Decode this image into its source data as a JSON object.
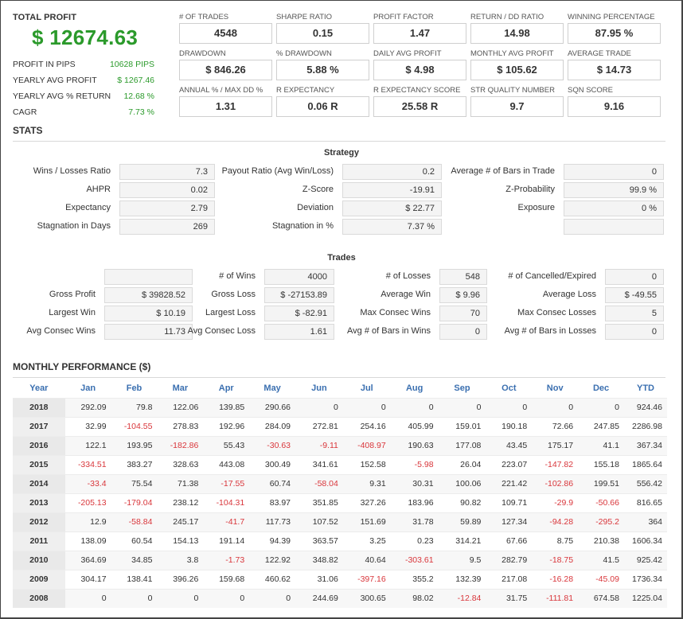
{
  "summary": {
    "title": "TOTAL PROFIT",
    "total": "$ 12674.63",
    "rows": [
      {
        "k": "PROFIT IN PIPS",
        "v": "10628 PIPS"
      },
      {
        "k": "YEARLY AVG PROFIT",
        "v": "$ 1267.46"
      },
      {
        "k": "YEARLY AVG % RETURN",
        "v": "12.68 %"
      },
      {
        "k": "CAGR",
        "v": "7.73 %"
      }
    ]
  },
  "kpis": [
    {
      "t": "# OF TRADES",
      "v": "4548"
    },
    {
      "t": "SHARPE RATIO",
      "v": "0.15"
    },
    {
      "t": "PROFIT FACTOR",
      "v": "1.47"
    },
    {
      "t": "RETURN / DD RATIO",
      "v": "14.98"
    },
    {
      "t": "WINNING PERCENTAGE",
      "v": "87.95 %"
    },
    {
      "t": "DRAWDOWN",
      "v": "$ 846.26"
    },
    {
      "t": "% DRAWDOWN",
      "v": "5.88 %"
    },
    {
      "t": "DAILY AVG PROFIT",
      "v": "$ 4.98"
    },
    {
      "t": "MONTHLY AVG PROFIT",
      "v": "$ 105.62"
    },
    {
      "t": "AVERAGE TRADE",
      "v": "$ 14.73"
    },
    {
      "t": "ANNUAL % / MAX DD %",
      "v": "1.31"
    },
    {
      "t": "R EXPECTANCY",
      "v": "0.06 R"
    },
    {
      "t": "R EXPECTANCY SCORE",
      "v": "25.58 R"
    },
    {
      "t": "STR QUALITY NUMBER",
      "v": "9.7"
    },
    {
      "t": "SQN SCORE",
      "v": "9.16"
    }
  ],
  "stats": {
    "title": "STATS",
    "strategy_title": "Strategy",
    "strategy": [
      [
        {
          "l": "Wins / Losses Ratio",
          "v": "7.3"
        },
        {
          "l": "Payout Ratio (Avg Win/Loss)",
          "v": "0.2"
        },
        {
          "l": "Average # of Bars in Trade",
          "v": "0"
        }
      ],
      [
        {
          "l": "AHPR",
          "v": "0.02"
        },
        {
          "l": "Z-Score",
          "v": "-19.91"
        },
        {
          "l": "Z-Probability",
          "v": "99.9 %"
        }
      ],
      [
        {
          "l": "Expectancy",
          "v": "2.79"
        },
        {
          "l": "Deviation",
          "v": "$ 22.77"
        },
        {
          "l": "Exposure",
          "v": "0 %"
        }
      ],
      [
        {
          "l": "Stagnation in Days",
          "v": "269"
        },
        {
          "l": "Stagnation in %",
          "v": "7.37 %"
        },
        {
          "l": "",
          "v": ""
        }
      ]
    ],
    "trades_title": "Trades",
    "trades": [
      [
        {
          "l": "",
          "v": ""
        },
        {
          "l": "# of Wins",
          "v": "4000"
        },
        {
          "l": "# of Losses",
          "v": "548"
        },
        {
          "l": "# of Cancelled/Expired",
          "v": "0"
        }
      ],
      [
        {
          "l": "Gross Profit",
          "v": "$ 39828.52"
        },
        {
          "l": "Gross Loss",
          "v": "$ -27153.89"
        },
        {
          "l": "Average Win",
          "v": "$ 9.96"
        },
        {
          "l": "Average Loss",
          "v": "$ -49.55"
        }
      ],
      [
        {
          "l": "Largest Win",
          "v": "$ 10.19"
        },
        {
          "l": "Largest Loss",
          "v": "$ -82.91"
        },
        {
          "l": "Max Consec Wins",
          "v": "70"
        },
        {
          "l": "Max Consec Losses",
          "v": "5"
        }
      ],
      [
        {
          "l": "Avg Consec Wins",
          "v": "11.73"
        },
        {
          "l": "Avg Consec Loss",
          "v": "1.61"
        },
        {
          "l": "Avg # of Bars in Wins",
          "v": "0"
        },
        {
          "l": "Avg # of Bars in Losses",
          "v": "0"
        }
      ]
    ]
  },
  "monthly": {
    "title": "MONTHLY PERFORMANCE ($)",
    "headers": [
      "Year",
      "Jan",
      "Feb",
      "Mar",
      "Apr",
      "May",
      "Jun",
      "Jul",
      "Aug",
      "Sep",
      "Oct",
      "Nov",
      "Dec",
      "YTD"
    ],
    "rows": [
      [
        "2018",
        "292.09",
        "79.8",
        "122.06",
        "139.85",
        "290.66",
        "0",
        "0",
        "0",
        "0",
        "0",
        "0",
        "0",
        "924.46"
      ],
      [
        "2017",
        "32.99",
        "-104.55",
        "278.83",
        "192.96",
        "284.09",
        "272.81",
        "254.16",
        "405.99",
        "159.01",
        "190.18",
        "72.66",
        "247.85",
        "2286.98"
      ],
      [
        "2016",
        "122.1",
        "193.95",
        "-182.86",
        "55.43",
        "-30.63",
        "-9.11",
        "-408.97",
        "190.63",
        "177.08",
        "43.45",
        "175.17",
        "41.1",
        "367.34"
      ],
      [
        "2015",
        "-334.51",
        "383.27",
        "328.63",
        "443.08",
        "300.49",
        "341.61",
        "152.58",
        "-5.98",
        "26.04",
        "223.07",
        "-147.82",
        "155.18",
        "1865.64"
      ],
      [
        "2014",
        "-33.4",
        "75.54",
        "71.38",
        "-17.55",
        "60.74",
        "-58.04",
        "9.31",
        "30.31",
        "100.06",
        "221.42",
        "-102.86",
        "199.51",
        "556.42"
      ],
      [
        "2013",
        "-205.13",
        "-179.04",
        "238.12",
        "-104.31",
        "83.97",
        "351.85",
        "327.26",
        "183.96",
        "90.82",
        "109.71",
        "-29.9",
        "-50.66",
        "816.65"
      ],
      [
        "2012",
        "12.9",
        "-58.84",
        "245.17",
        "-41.7",
        "117.73",
        "107.52",
        "151.69",
        "31.78",
        "59.89",
        "127.34",
        "-94.28",
        "-295.2",
        "364"
      ],
      [
        "2011",
        "138.09",
        "60.54",
        "154.13",
        "191.14",
        "94.39",
        "363.57",
        "3.25",
        "0.23",
        "314.21",
        "67.66",
        "8.75",
        "210.38",
        "1606.34"
      ],
      [
        "2010",
        "364.69",
        "34.85",
        "3.8",
        "-1.73",
        "122.92",
        "348.82",
        "40.64",
        "-303.61",
        "9.5",
        "282.79",
        "-18.75",
        "41.5",
        "925.42"
      ],
      [
        "2009",
        "304.17",
        "138.41",
        "396.26",
        "159.68",
        "460.62",
        "31.06",
        "-397.16",
        "355.2",
        "132.39",
        "217.08",
        "-16.28",
        "-45.09",
        "1736.34"
      ],
      [
        "2008",
        "0",
        "0",
        "0",
        "0",
        "0",
        "244.69",
        "300.65",
        "98.02",
        "-12.84",
        "31.75",
        "-111.81",
        "674.58",
        "1225.04"
      ]
    ]
  },
  "colors": {
    "profit_green": "#2b9a2b",
    "negative_red": "#d9363b",
    "header_blue": "#3a6fb0"
  }
}
